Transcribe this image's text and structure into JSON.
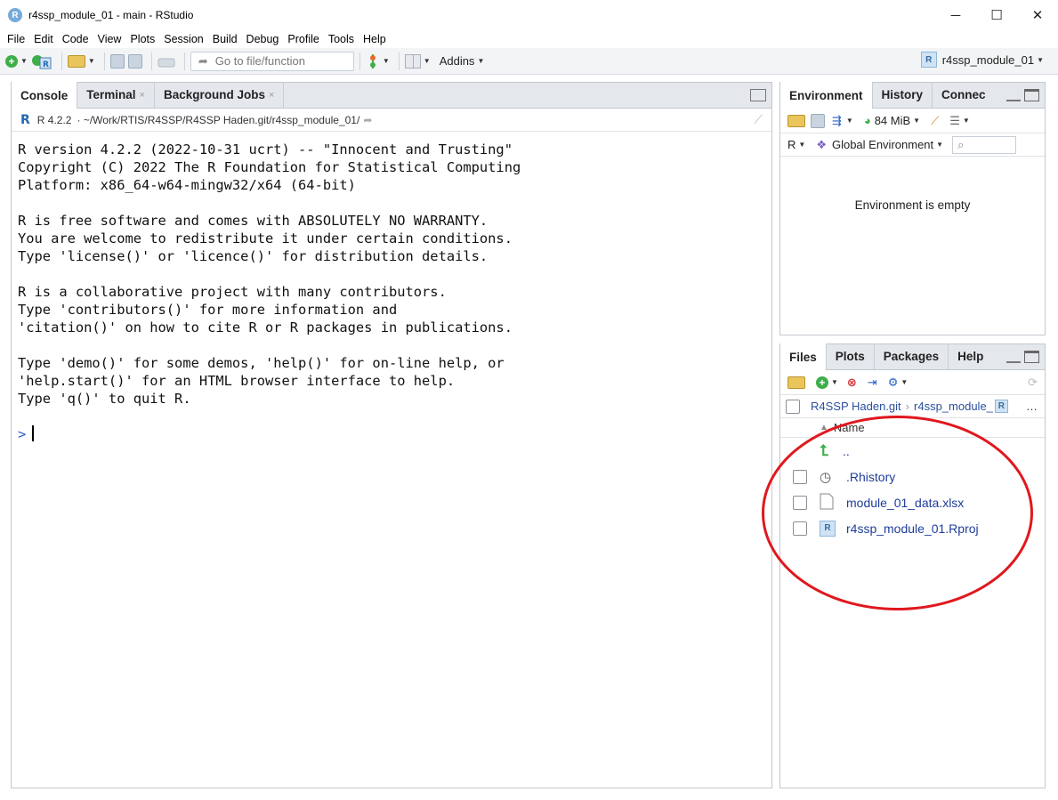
{
  "window": {
    "title": "r4ssp_module_01 - main - RStudio",
    "app_icon": "R",
    "controls": [
      "─",
      "☐",
      "✕"
    ]
  },
  "menu": [
    "File",
    "Edit",
    "Code",
    "View",
    "Plots",
    "Session",
    "Build",
    "Debug",
    "Profile",
    "Tools",
    "Help"
  ],
  "toolbar": {
    "goto_placeholder": "Go to file/function",
    "addins_label": "Addins",
    "project_name": "r4ssp_module_01",
    "project_icon": "R"
  },
  "console_pane": {
    "tabs": [
      {
        "label": "Console",
        "closable": false
      },
      {
        "label": "Terminal",
        "closable": true
      },
      {
        "label": "Background Jobs",
        "closable": true
      }
    ],
    "close_glyph": "×",
    "r_logo": "R",
    "r_version": "R 4.2.2",
    "path": "· ~/Work/RTIS/R4SSP/R4SSP Haden.git/r4ssp_module_01/",
    "output": "R version 4.2.2 (2022-10-31 ucrt) -- \"Innocent and Trusting\"\nCopyright (C) 2022 The R Foundation for Statistical Computing\nPlatform: x86_64-w64-mingw32/x64 (64-bit)\n\nR is free software and comes with ABSOLUTELY NO WARRANTY.\nYou are welcome to redistribute it under certain conditions.\nType 'license()' or 'licence()' for distribution details.\n\nR is a collaborative project with many contributors.\nType 'contributors()' for more information and\n'citation()' on how to cite R or R packages in publications.\n\nType 'demo()' for some demos, 'help()' for on-line help, or\n'help.start()' for an HTML browser interface to help.\nType 'q()' to quit R.\n",
    "prompt": ">"
  },
  "env_pane": {
    "tabs": [
      "Environment",
      "History",
      "Connec"
    ],
    "memory": "84 MiB",
    "language": "R",
    "scope": "Global Environment",
    "empty_message": "Environment is empty"
  },
  "files_pane": {
    "tabs": [
      "Files",
      "Plots",
      "Packages",
      "Help"
    ],
    "breadcrumb": [
      "R4SSP Haden.git",
      "r4ssp_module_"
    ],
    "breadcrumb_more": "…",
    "column_name": "Name",
    "parent_dir": "..",
    "files": [
      {
        "name": ".Rhistory",
        "icon": "history-file-icon"
      },
      {
        "name": "module_01_data.xlsx",
        "icon": "document-icon"
      },
      {
        "name": "r4ssp_module_01.Rproj",
        "icon": "rproj-icon"
      }
    ]
  },
  "annotation": {
    "color": "#e0181e",
    "shape": "ellipse",
    "target": "files-list"
  }
}
